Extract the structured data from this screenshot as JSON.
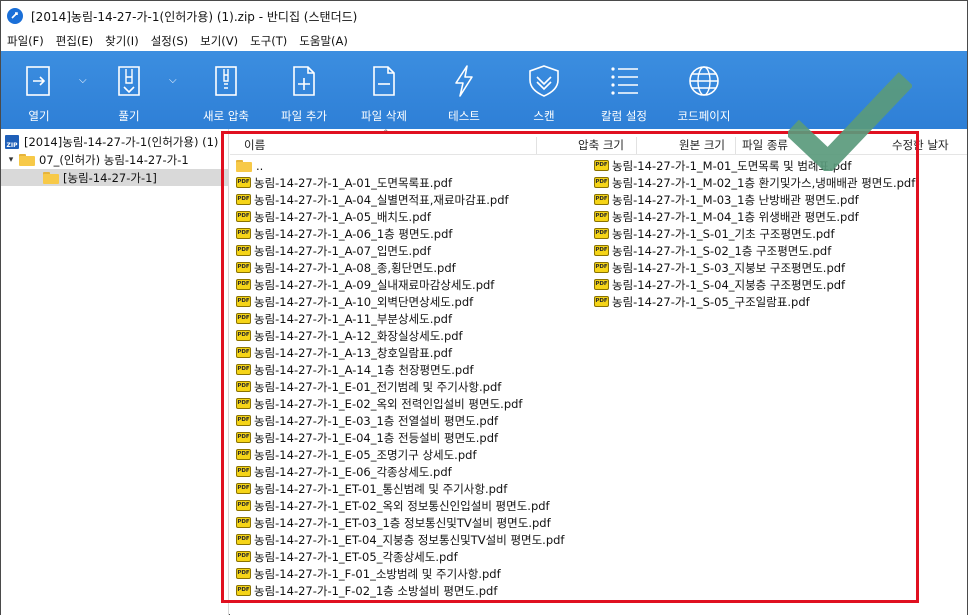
{
  "window": {
    "title": "[2014]농림-14-27-가-1(인허가용) (1).zip - 반디집 (스탠더드)"
  },
  "menu": [
    "파일(F)",
    "편집(E)",
    "찾기(I)",
    "설정(S)",
    "보기(V)",
    "도구(T)",
    "도움말(A)"
  ],
  "toolbar": {
    "open": "열기",
    "extract": "풀기",
    "new_archive": "새로 압축",
    "add_file": "파일 추가",
    "delete_file": "파일 삭제",
    "test": "테스트",
    "scan": "스캔",
    "columns": "칼럼 설정",
    "codepage": "코드페이지"
  },
  "tree": {
    "root": "[2014]농림-14-27-가-1(인허가용) (1)",
    "folder": "07_(인허가) 농림-14-27-가-1",
    "selected": "[농림-14-27-가-1]"
  },
  "columns": {
    "name": "이름",
    "compressed": "압축 크기",
    "original": "원본 크기",
    "type": "파일 종류",
    "modified": "수정한 날자"
  },
  "parent_folder": "..",
  "files_left": [
    "농림-14-27-가-1_A-01_도면목록표.pdf",
    "농림-14-27-가-1_A-04_실별면적표,재료마감표.pdf",
    "농림-14-27-가-1_A-05_배치도.pdf",
    "농림-14-27-가-1_A-06_1층 평면도.pdf",
    "농림-14-27-가-1_A-07_입면도.pdf",
    "농림-14-27-가-1_A-08_종,횡단면도.pdf",
    "농림-14-27-가-1_A-09_실내재료마감상세도.pdf",
    "농림-14-27-가-1_A-10_외벽단면상세도.pdf",
    "농림-14-27-가-1_A-11_부분상세도.pdf",
    "농림-14-27-가-1_A-12_화장실상세도.pdf",
    "농림-14-27-가-1_A-13_창호일람표.pdf",
    "농림-14-27-가-1_A-14_1층 천장평면도.pdf",
    "농림-14-27-가-1_E-01_전기범례 및 주기사항.pdf",
    "농림-14-27-가-1_E-02_옥외 전력인입설비 평면도.pdf",
    "농림-14-27-가-1_E-03_1층 전열설비 평면도.pdf",
    "농림-14-27-가-1_E-04_1층 전등설비 평면도.pdf",
    "농림-14-27-가-1_E-05_조명기구 상세도.pdf",
    "농림-14-27-가-1_E-06_각종상세도.pdf",
    "농림-14-27-가-1_ET-01_통신범례 및 주기사항.pdf",
    "농림-14-27-가-1_ET-02_옥외 정보통신인입설비 평면도.pdf",
    "농림-14-27-가-1_ET-03_1층 정보통신및TV설비 평면도.pdf",
    "농림-14-27-가-1_ET-04_지붕층 정보통신및TV설비 평면도.pdf",
    "농림-14-27-가-1_ET-05_각종상세도.pdf",
    "농림-14-27-가-1_F-01_소방범례 및 주기사항.pdf",
    "농림-14-27-가-1_F-02_1층 소방설비 평면도.pdf"
  ],
  "files_right": [
    "농림-14-27-가-1_M-01_도면목록 및 범례표.pdf",
    "농림-14-27-가-1_M-02_1층 환기및가스,냉매배관 평면도.pdf",
    "농림-14-27-가-1_M-03_1층 난방배관 평면도.pdf",
    "농림-14-27-가-1_M-04_1층 위생배관 평면도.pdf",
    "농림-14-27-가-1_S-01_기초 구조평면도.pdf",
    "농림-14-27-가-1_S-02_1층 구조평면도.pdf",
    "농림-14-27-가-1_S-03_지붕보 구조평면도.pdf",
    "농림-14-27-가-1_S-04_지붕층 구조평면도.pdf",
    "농림-14-27-가-1_S-05_구조일람표.pdf"
  ],
  "colors": {
    "toolbar": "#2e7fd6",
    "highlight": "#e01020",
    "check": "#5a9a7c"
  }
}
